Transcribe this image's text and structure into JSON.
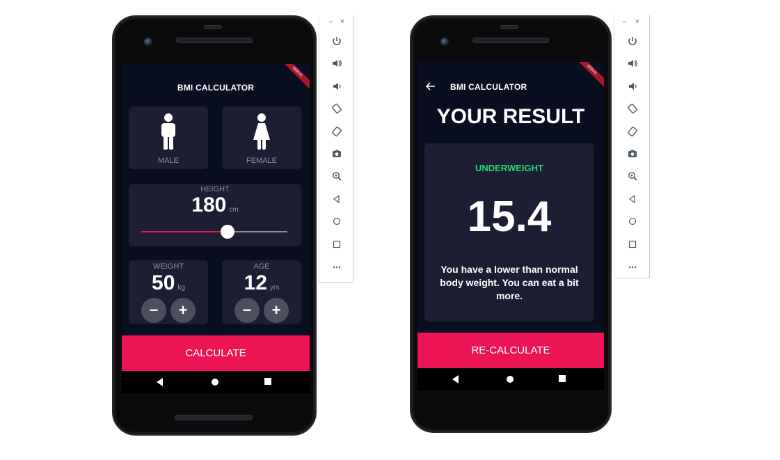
{
  "input_screen": {
    "app_title": "BMI CALCULATOR",
    "debug_banner": "DEBUG",
    "gender_cards": [
      {
        "label": "MALE",
        "icon": "male-icon"
      },
      {
        "label": "FEMALE",
        "icon": "female-icon"
      }
    ],
    "height": {
      "label": "HEIGHT",
      "value": "180",
      "unit": "cm",
      "slider_fraction": 0.59
    },
    "weight": {
      "label": "WEIGHT",
      "value": "50",
      "unit": "kg",
      "minus": "−",
      "plus": "+"
    },
    "age": {
      "label": "AGE",
      "value": "12",
      "unit": "yrs",
      "minus": "−",
      "plus": "+"
    },
    "calculate_label": "CALCULATE"
  },
  "result_screen": {
    "app_title": "BMI CALCULATOR",
    "debug_banner": "DEBUG",
    "heading": "YOUR RESULT",
    "status": "UNDERWEIGHT",
    "bmi_value": "15.4",
    "advice": "You have a lower than normal body weight. You can eat a bit more.",
    "recalculate_label": "RE-CALCULATE"
  },
  "emulator_toolbar": {
    "minimize_glyph": "–",
    "close_glyph": "×",
    "buttons": [
      "power-icon",
      "volume-up-icon",
      "volume-down-icon",
      "rotate-left-icon",
      "rotate-right-icon",
      "screenshot-icon",
      "zoom-icon",
      "back-icon",
      "home-icon",
      "overview-icon",
      "more-icon"
    ]
  },
  "colors": {
    "background": "#0a0e21",
    "card": "#1d1e33",
    "accent": "#eb1555",
    "inactive_text": "#8d8e98",
    "underweight_green": "#24d876",
    "round_button": "#4c4f5e"
  }
}
